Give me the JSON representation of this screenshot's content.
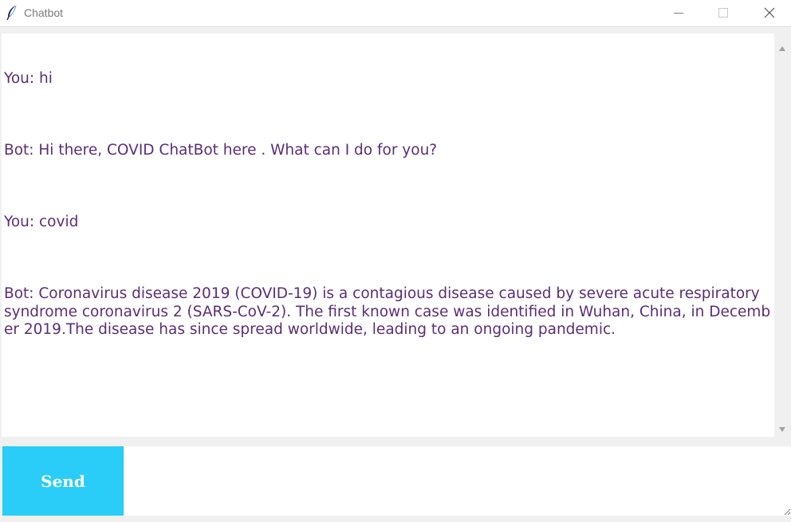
{
  "window": {
    "title": "Chatbot",
    "icon": "feather-icon",
    "controls": [
      "minimize-icon",
      "maximize-icon",
      "close-icon"
    ]
  },
  "chat": {
    "lines": [
      "You: hi",
      "Bot: Hi there, COVID ChatBot here . What can I do for you?",
      "You: covid",
      "Bot: Coronavirus disease 2019 (COVID-19) is a contagious disease caused by severe acute respiratory syndrome coronavirus 2 (SARS-CoV-2). The first known case was identified in Wuhan, China, in December 2019.The disease has since spread worldwide, leading to an ongoing pandemic."
    ],
    "text_color": "#5a2e79"
  },
  "composer": {
    "send_label": "Send",
    "send_color": "#29cdf8",
    "input_value": ""
  }
}
